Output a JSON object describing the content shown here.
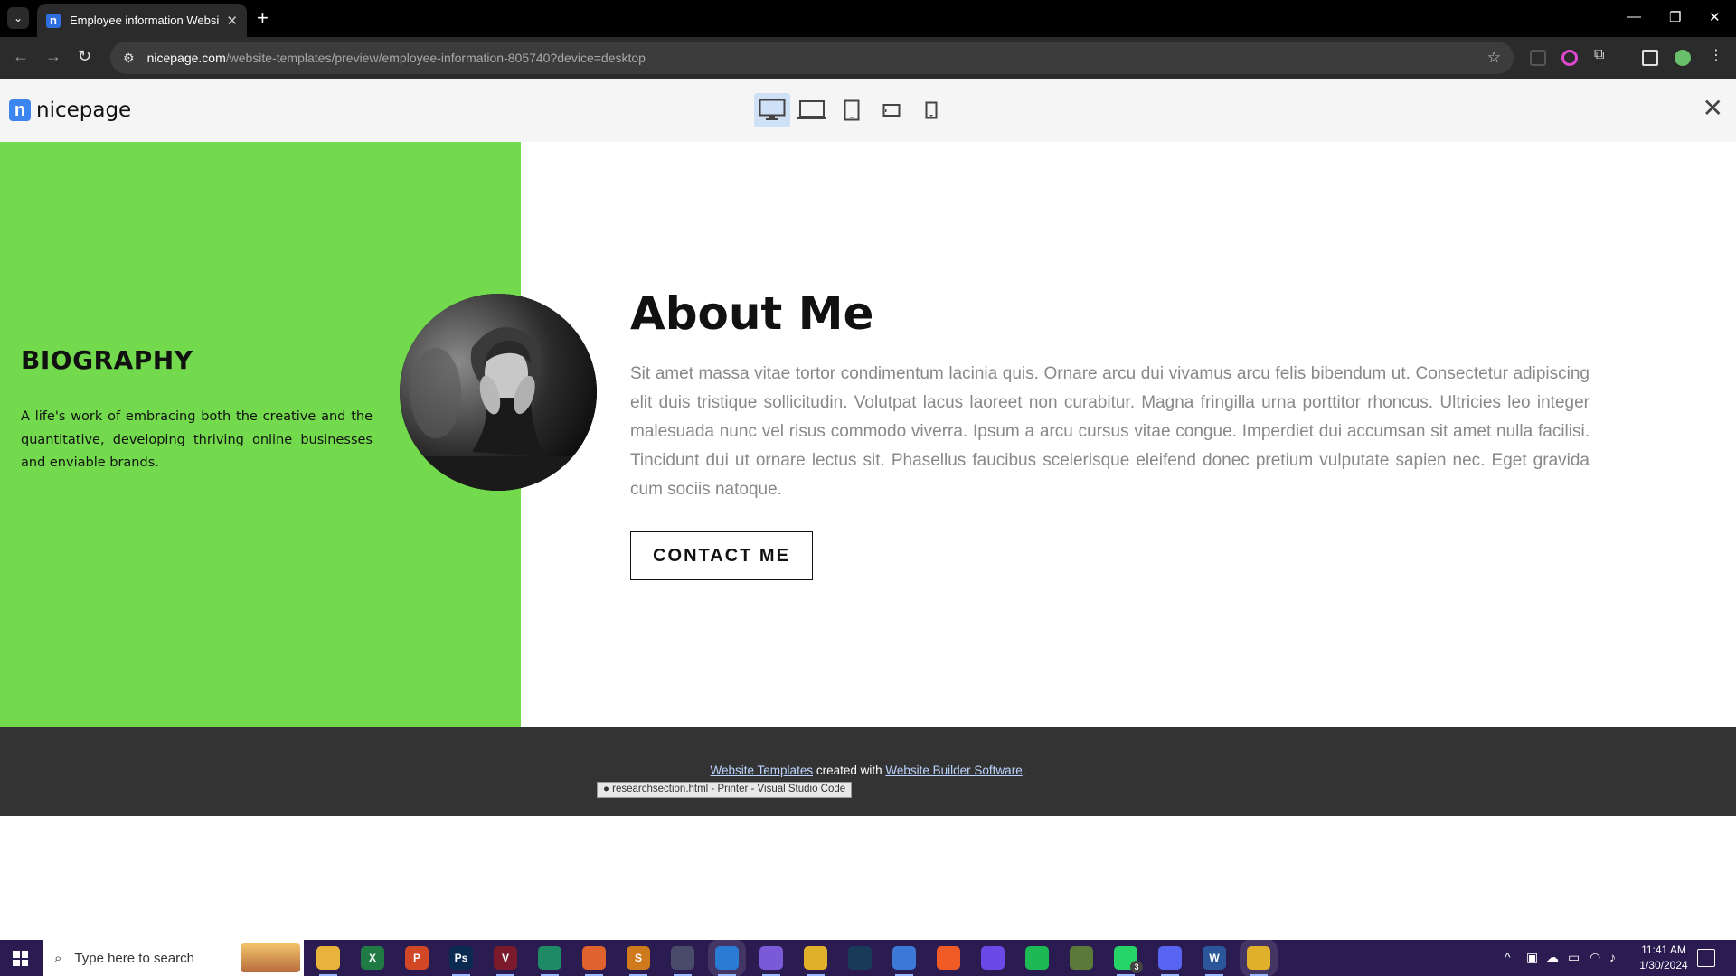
{
  "browser": {
    "tab_title": "Employee information Website",
    "new_tab_label": "+",
    "url_host": "nicepage.com",
    "url_path": "/website-templates/preview/employee-information-805740?device=desktop"
  },
  "preview": {
    "logo_mark": "n",
    "logo_text": "nicepage",
    "devices": [
      {
        "name": "desktop-large",
        "active": true
      },
      {
        "name": "laptop",
        "active": false
      },
      {
        "name": "tablet",
        "active": false
      },
      {
        "name": "phone-landscape",
        "active": false
      },
      {
        "name": "phone",
        "active": false
      }
    ]
  },
  "page": {
    "biography": {
      "heading": "BIOGRAPHY",
      "text": "A life's work of embracing both the creative and the quantitative, developing thriving online businesses and enviable brands."
    },
    "about": {
      "title": "About Me",
      "text": "Sit amet massa vitae tortor condimentum lacinia quis. Ornare arcu dui vivamus arcu felis bibendum ut. Consectetur adipiscing elit duis tristique sollicitudin. Volutpat lacus laoreet non curabitur. Magna fringilla urna porttitor rhoncus. Ultricies leo integer malesuada nunc vel risus commodo viverra. Ipsum a arcu cursus vitae congue. Imperdiet dui accumsan sit amet nulla facilisi. Tincidunt dui ut ornare lectus sit. Phasellus faucibus scelerisque eleifend donec pretium vulputate sapien nec. Eget gravida cum sociis natoque.",
      "button_label": "CONTACT ME"
    },
    "footer": {
      "link1": "Website Templates",
      "middle": " created with ",
      "link2": "Website Builder Software",
      "end": "."
    },
    "tooltip": "● researchsection.html - Printer - Visual Studio Code"
  },
  "taskbar": {
    "search_placeholder": "Type here to search",
    "apps": [
      {
        "name": "file-explorer",
        "label": "",
        "color": "#e8b33a"
      },
      {
        "name": "excel",
        "label": "X",
        "color": "#1f7a44"
      },
      {
        "name": "powerpoint",
        "label": "P",
        "color": "#d24726"
      },
      {
        "name": "photoshop",
        "label": "Ps",
        "color": "#0a2a52"
      },
      {
        "name": "vectr",
        "label": "V",
        "color": "#7a1a2a"
      },
      {
        "name": "sublime-merge",
        "label": "",
        "color": "#1f8a66"
      },
      {
        "name": "xampp",
        "label": "",
        "color": "#e0622c"
      },
      {
        "name": "sublime-text",
        "label": "S",
        "color": "#d07a1e"
      },
      {
        "name": "inkscape",
        "label": "",
        "color": "#4a4a6a"
      },
      {
        "name": "vscode",
        "label": "",
        "color": "#2a7bd4"
      },
      {
        "name": "viber",
        "label": "",
        "color": "#7a5ad6"
      },
      {
        "name": "chrome",
        "label": "",
        "color": "#e0b02a"
      },
      {
        "name": "steam",
        "label": "",
        "color": "#1a3a5a"
      },
      {
        "name": "chrome-profile",
        "label": "",
        "color": "#3a7ad6"
      },
      {
        "name": "brave",
        "label": "",
        "color": "#f05a24"
      },
      {
        "name": "proton",
        "label": "",
        "color": "#6a4ae6"
      },
      {
        "name": "spotify",
        "label": "",
        "color": "#1db954"
      },
      {
        "name": "minecraft",
        "label": "",
        "color": "#5a7a3a"
      },
      {
        "name": "whatsapp",
        "label": "",
        "color": "#25d366"
      },
      {
        "name": "discord",
        "label": "",
        "color": "#5865f2"
      },
      {
        "name": "word",
        "label": "W",
        "color": "#2b579a"
      },
      {
        "name": "chrome-active",
        "label": "",
        "color": "#e0b02a"
      }
    ],
    "whatsapp_badge": "3",
    "time": "11:41 AM",
    "date": "1/30/2024"
  }
}
